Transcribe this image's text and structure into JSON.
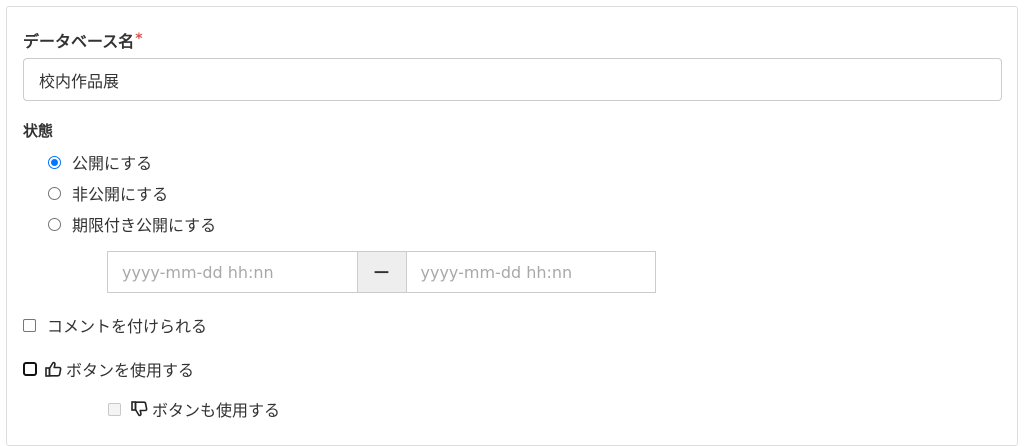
{
  "form": {
    "db_name_label": "データベース名",
    "required_mark": "*",
    "db_name_value": "校内作品展",
    "state_label": "状態",
    "state_options": [
      {
        "label": "公開にする",
        "checked": true
      },
      {
        "label": "非公開にする",
        "checked": false
      },
      {
        "label": "期限付き公開にする",
        "checked": false
      }
    ],
    "date_start_placeholder": "yyyy-mm-dd hh:nn",
    "date_separator": "－",
    "date_end_placeholder": "yyyy-mm-dd hh:nn",
    "allow_comments_label": "コメントを付けられる",
    "like_button_label": "ボタンを使用する",
    "dislike_button_label": "ボタンも使用する"
  },
  "icons": {
    "like": "thumbs-up-icon",
    "dislike": "thumbs-down-icon"
  },
  "colors": {
    "accent": "#0075ff",
    "required": "#d9534f"
  }
}
